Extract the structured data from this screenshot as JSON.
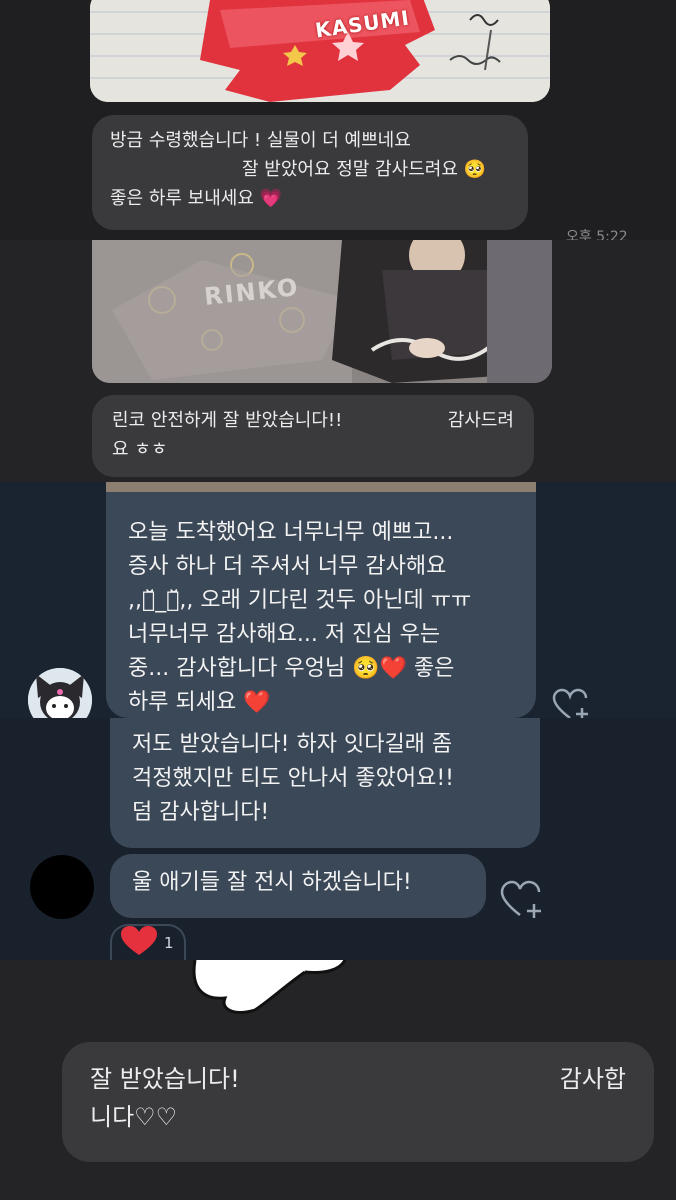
{
  "screenshot_1": {
    "photo_label": "KASUMI",
    "message_line1": "방금 수령했습니다 ! 실물이 더 예쁘네요",
    "message_line2": "잘 받았어요 정말 감사드려요 🥺",
    "message_line3": "좋은 하루 보내세요 💗",
    "time": "오후 5:22"
  },
  "screenshot_2": {
    "photo_label": "RINKO",
    "message_line1a": "린코 안전하게 잘 받았습니다!!",
    "message_line1b": "감사드려",
    "message_line2": "요 ㅎㅎ"
  },
  "screenshot_3": {
    "message_lines": [
      "오늘 도착했어요 너무너무 예쁘고...",
      "증사 하나 더 주셔서 너무 감사해요",
      ",,ㅎ̆̈_ㅎ̆̈,, 오래 기다린 것두 아닌데 ㅠㅠ",
      "너무너무 감사해요... 저 진심 우는",
      "중... 감사합니다 우엉님 🥺❤️ 좋은",
      "하루 되세요 ❤️"
    ]
  },
  "screenshot_4": {
    "message1_lines": [
      "저도 받았습니다! 하자 잇다길래 좀",
      "걱정했지만 티도 안나서 좋았어요!!",
      "덤 감사합니다!"
    ],
    "message2": "울 애기들 잘 전시 하겠습니다!",
    "reaction_count": "1"
  },
  "screenshot_5": {
    "message_line1a": "잘 받았습니다!",
    "message_line1b": "감사합",
    "message_line2": "니다♡♡"
  },
  "colors": {
    "heart": "#e5303e",
    "pink_heart": "#ec6bb0",
    "bubble_gray": "#3a3a3d",
    "bubble_slate": "#3b4858"
  }
}
